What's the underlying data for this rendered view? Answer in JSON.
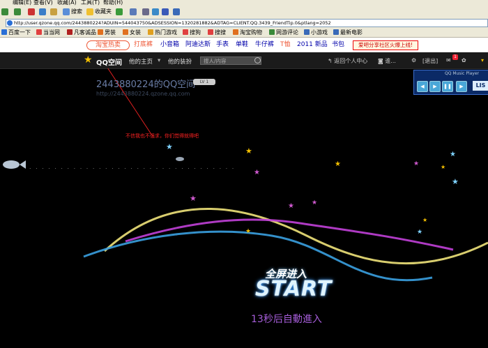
{
  "menubar": {
    "items": [
      "编辑(E)",
      "查看(V)",
      "收藏(A)",
      "工具(T)",
      "帮助(H)"
    ]
  },
  "toolbar": {
    "search_label": "搜索",
    "favorites_label": "收藏夹"
  },
  "address": {
    "url": "http://user.qzone.qq.com/2443880224?ADUIN=544043750&ADSESSION=1320281882&ADTAG=CLIENT.QQ.3439_FriendTip.0&ptlang=2052"
  },
  "links": [
    "百度一下",
    "当当网",
    "凡客诚品",
    "男装",
    "女装",
    "热门游戏",
    "搜狗",
    "搜搜",
    "淘宝购物",
    "网游评论",
    "小游戏",
    "最新电影"
  ],
  "promo": {
    "taobao": "淘宝热卖",
    "items": [
      "打底裤",
      "小音箱",
      "阿迪达斯",
      "手表",
      "单鞋",
      "牛仔裤",
      "T恤",
      "2011 新品",
      "书包"
    ],
    "share": "爱吧分享社区火爆上线!"
  },
  "qzone": {
    "logo": "QQ空间",
    "nav_home": "他的主页",
    "nav_share": "他的装扮",
    "search_placeholder": "搜人/内容",
    "back_label": "返回个人中心",
    "notify_count": "1",
    "exit_label": "[退出]"
  },
  "profile": {
    "title": "2443880224的QQ空间",
    "url": "http://2443880224.qzone.qq.com",
    "level": "LV 1"
  },
  "music": {
    "title": "QQ Music Player",
    "list": "LIS"
  },
  "annotation": "不信我也不强求，你们觉得就得吧",
  "intro": {
    "start_cn": "全屏进入",
    "start_en": "START",
    "countdown": "13秒后自動進入"
  },
  "colors": {
    "accent": "#f4c000",
    "purple": "#a55dd8",
    "blue": "#3aa0e0",
    "yellow": "#f0e37a",
    "magenta": "#c140d8"
  }
}
